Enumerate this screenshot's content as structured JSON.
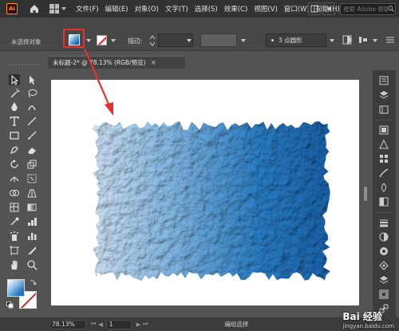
{
  "app": {
    "logo_text": "Ai"
  },
  "menu": {
    "items": [
      "文件(F)",
      "编辑(E)",
      "对象(O)",
      "文字(T)",
      "选择(S)",
      "效果(C)",
      "视图(V)",
      "窗口(W)",
      "帮助(H)"
    ],
    "search_placeholder": "搜索 Adobe 帮助"
  },
  "control_bar": {
    "selection_label": "未选择对象",
    "stroke_label": "描边:",
    "brush_label": "3 点圆形",
    "fill_type": "gradient",
    "stroke_color": "none"
  },
  "document": {
    "tab_title": "未标题-2* @ 78.13% (RGB/预览)"
  },
  "canvas": {
    "texture_colors": [
      "#cfe4f6",
      "#7fb6e3",
      "#2a7fc6",
      "#1a62aa"
    ],
    "artboard_color": "#ffffff"
  },
  "status_bar": {
    "zoom": "78.13%",
    "page": "1",
    "tool_label": "编组选择"
  },
  "watermark": {
    "main": "Bai 经验",
    "sub": "jingyan.baidu.com"
  },
  "colors": {
    "annotation": "#e53030",
    "ui_dark": "#323232",
    "ui_mid": "#535353"
  }
}
